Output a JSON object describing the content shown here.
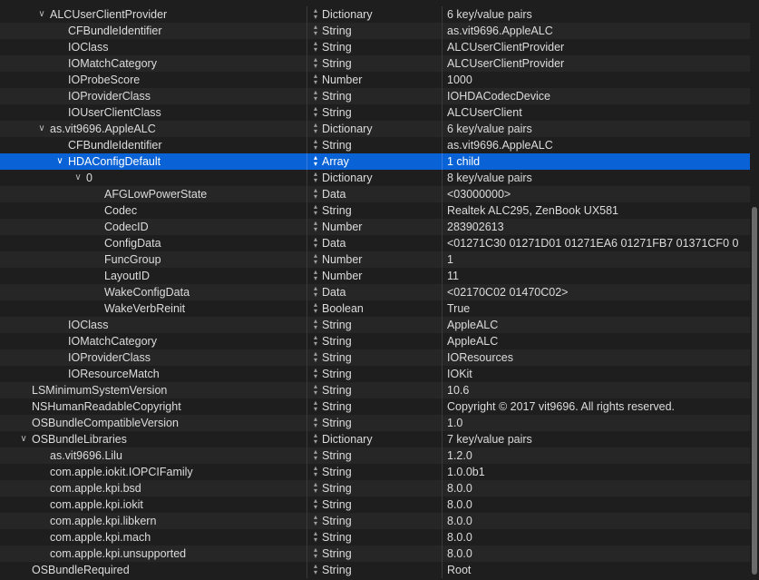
{
  "rows": [
    {
      "key": "ALCUserClientProvider",
      "type": "Dictionary",
      "value": "6 key/value pairs",
      "depth": 1,
      "disclosure": "expanded"
    },
    {
      "key": "CFBundleIdentifier",
      "type": "String",
      "value": "as.vit9696.AppleALC",
      "depth": 2
    },
    {
      "key": "IOClass",
      "type": "String",
      "value": "ALCUserClientProvider",
      "depth": 2
    },
    {
      "key": "IOMatchCategory",
      "type": "String",
      "value": "ALCUserClientProvider",
      "depth": 2
    },
    {
      "key": "IOProbeScore",
      "type": "Number",
      "value": "1000",
      "depth": 2
    },
    {
      "key": "IOProviderClass",
      "type": "String",
      "value": "IOHDACodecDevice",
      "depth": 2
    },
    {
      "key": "IOUserClientClass",
      "type": "String",
      "value": "ALCUserClient",
      "depth": 2
    },
    {
      "key": "as.vit9696.AppleALC",
      "type": "Dictionary",
      "value": "6 key/value pairs",
      "depth": 1,
      "disclosure": "expanded"
    },
    {
      "key": "CFBundleIdentifier",
      "type": "String",
      "value": "as.vit9696.AppleALC",
      "depth": 2
    },
    {
      "key": "HDAConfigDefault",
      "type": "Array",
      "value": "1 child",
      "depth": 2,
      "disclosure": "expanded",
      "selected": true
    },
    {
      "key": "0",
      "type": "Dictionary",
      "value": "8 key/value pairs",
      "depth": 3,
      "disclosure": "expanded"
    },
    {
      "key": "AFGLowPowerState",
      "type": "Data",
      "value": "<03000000>",
      "depth": 4
    },
    {
      "key": "Codec",
      "type": "String",
      "value": "Realtek ALC295, ZenBook UX581",
      "depth": 4
    },
    {
      "key": "CodecID",
      "type": "Number",
      "value": "283902613",
      "depth": 4
    },
    {
      "key": "ConfigData",
      "type": "Data",
      "value": "<01271C30 01271D01 01271EA6 01271FB7 01371CF0 0",
      "depth": 4
    },
    {
      "key": "FuncGroup",
      "type": "Number",
      "value": "1",
      "depth": 4
    },
    {
      "key": "LayoutID",
      "type": "Number",
      "value": "11",
      "depth": 4
    },
    {
      "key": "WakeConfigData",
      "type": "Data",
      "value": "<02170C02 01470C02>",
      "depth": 4
    },
    {
      "key": "WakeVerbReinit",
      "type": "Boolean",
      "value": "True",
      "depth": 4
    },
    {
      "key": "IOClass",
      "type": "String",
      "value": "AppleALC",
      "depth": 2
    },
    {
      "key": "IOMatchCategory",
      "type": "String",
      "value": "AppleALC",
      "depth": 2
    },
    {
      "key": "IOProviderClass",
      "type": "String",
      "value": "IOResources",
      "depth": 2
    },
    {
      "key": "IOResourceMatch",
      "type": "String",
      "value": "IOKit",
      "depth": 2
    },
    {
      "key": "LSMinimumSystemVersion",
      "type": "String",
      "value": "10.6",
      "depth": 0
    },
    {
      "key": "NSHumanReadableCopyright",
      "type": "String",
      "value": "Copyright © 2017 vit9696. All rights reserved.",
      "depth": 0
    },
    {
      "key": "OSBundleCompatibleVersion",
      "type": "String",
      "value": "1.0",
      "depth": 0
    },
    {
      "key": "OSBundleLibraries",
      "type": "Dictionary",
      "value": "7 key/value pairs",
      "depth": 0,
      "disclosure": "expanded"
    },
    {
      "key": "as.vit9696.Lilu",
      "type": "String",
      "value": "1.2.0",
      "depth": 1
    },
    {
      "key": "com.apple.iokit.IOPCIFamily",
      "type": "String",
      "value": "1.0.0b1",
      "depth": 1
    },
    {
      "key": "com.apple.kpi.bsd",
      "type": "String",
      "value": "8.0.0",
      "depth": 1
    },
    {
      "key": "com.apple.kpi.iokit",
      "type": "String",
      "value": "8.0.0",
      "depth": 1
    },
    {
      "key": "com.apple.kpi.libkern",
      "type": "String",
      "value": "8.0.0",
      "depth": 1
    },
    {
      "key": "com.apple.kpi.mach",
      "type": "String",
      "value": "8.0.0",
      "depth": 1
    },
    {
      "key": "com.apple.kpi.unsupported",
      "type": "String",
      "value": "8.0.0",
      "depth": 1
    },
    {
      "key": "OSBundleRequired",
      "type": "String",
      "value": "Root",
      "depth": 0
    }
  ],
  "icons": {
    "expanded": "chevron-down-icon",
    "type_stepper": "up-down-arrows-icon"
  },
  "colors": {
    "background": "#1e1e1e",
    "selection": "#0a63d6",
    "text": "#dcdcdc"
  }
}
